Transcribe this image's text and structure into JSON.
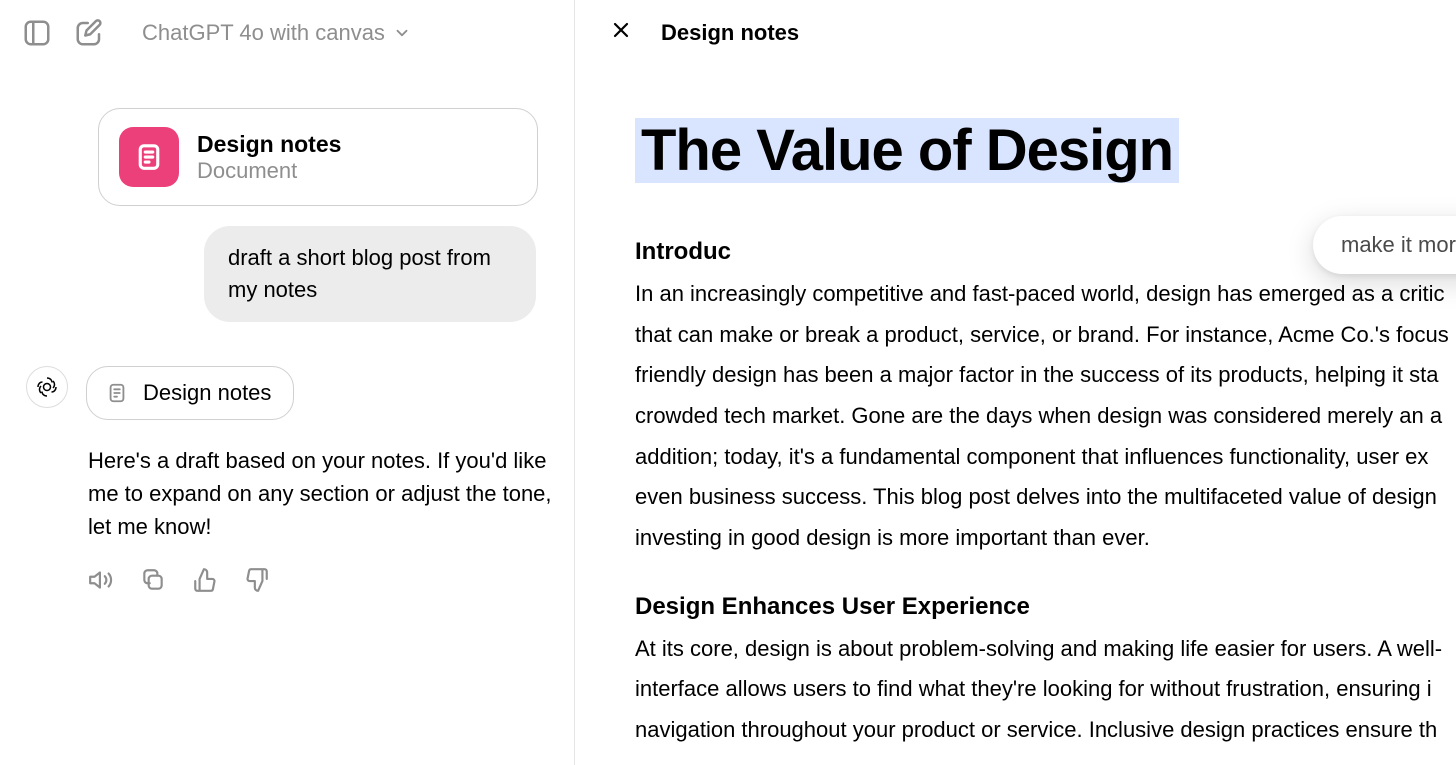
{
  "chat": {
    "model_label": "ChatGPT 4o with canvas",
    "attachment": {
      "title": "Design notes",
      "subtitle": "Document"
    },
    "user_message": "draft a short blog post from my notes",
    "assistant_chip": "Design notes",
    "assistant_text": "Here's a draft based on your notes. If you'd like me to expand on any section or adjust the tone, let me know!"
  },
  "canvas": {
    "top_title": "Design notes",
    "doc_heading": "The Value of Design",
    "intro_heading": "Introduc",
    "intro_body": "In an increasingly competitive and fast-paced world, design has emerged as a critic that can make or break a product, service, or brand. For instance, Acme Co.'s focus friendly design has been a major factor in the success of its products, helping it sta crowded tech market. Gone are the days when design was considered merely an a addition; today, it's a fundamental component that influences functionality, user ex even business success. This blog post delves into the multifaceted value of design investing in good design is more important than ever.",
    "section2_heading": "Design Enhances User Experience",
    "section2_body": "At its core, design is about problem-solving and making life easier for users. A well- interface allows users to find what they're looking for without frustration, ensuring i navigation throughout your product or service. Inclusive design practices ensure th",
    "edit_prompt": "make it more creative"
  },
  "colors": {
    "pink": "#ec407a",
    "highlight": "#d9e4ff"
  }
}
